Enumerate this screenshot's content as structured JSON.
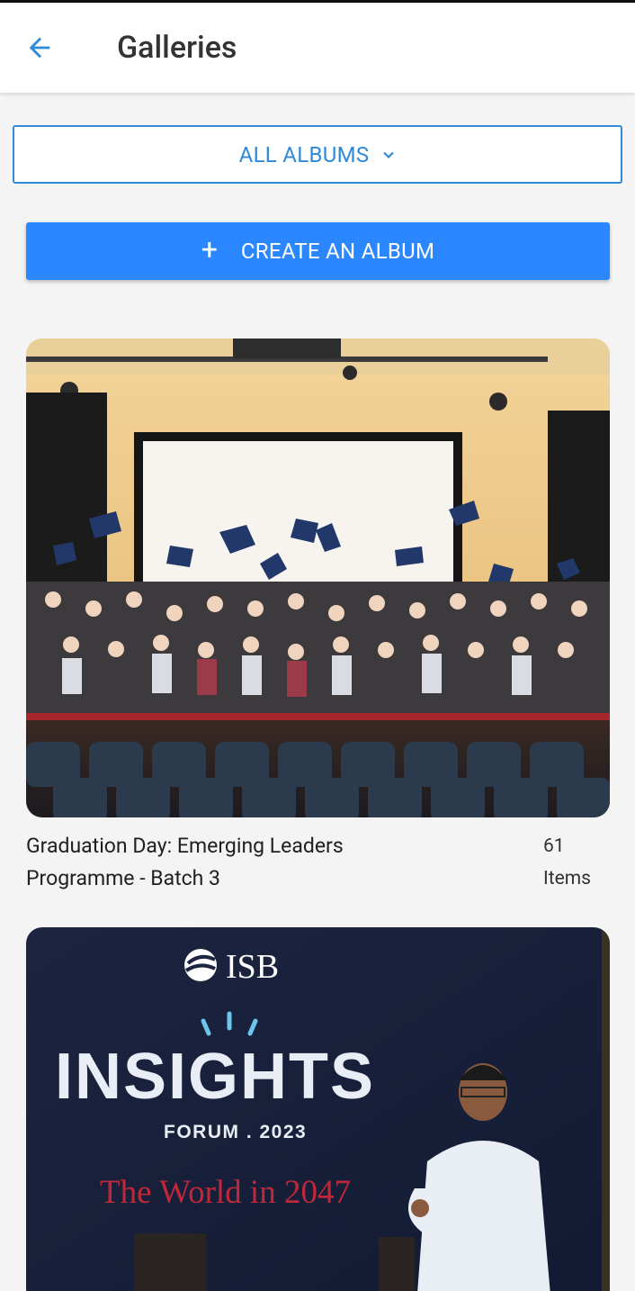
{
  "header": {
    "title": "Galleries",
    "back_icon": "arrow-left-icon"
  },
  "filter": {
    "label": "ALL ALBUMS",
    "icon": "chevron-down-icon"
  },
  "create_button": {
    "plus": "+",
    "label": "CREATE AN ALBUM"
  },
  "albums": [
    {
      "title_line1": "Graduation Day: Emerging Leaders",
      "title_line2": "Programme - Batch 3",
      "count": "61",
      "count_unit": "Items"
    },
    {
      "logo_text": "ISB",
      "headline": "INSIGHTS",
      "forum": "FORUM . 2023",
      "tagline": "The World in 2047"
    }
  ],
  "colors": {
    "accent": "#2f8ad8",
    "button": "#2b87ff"
  }
}
